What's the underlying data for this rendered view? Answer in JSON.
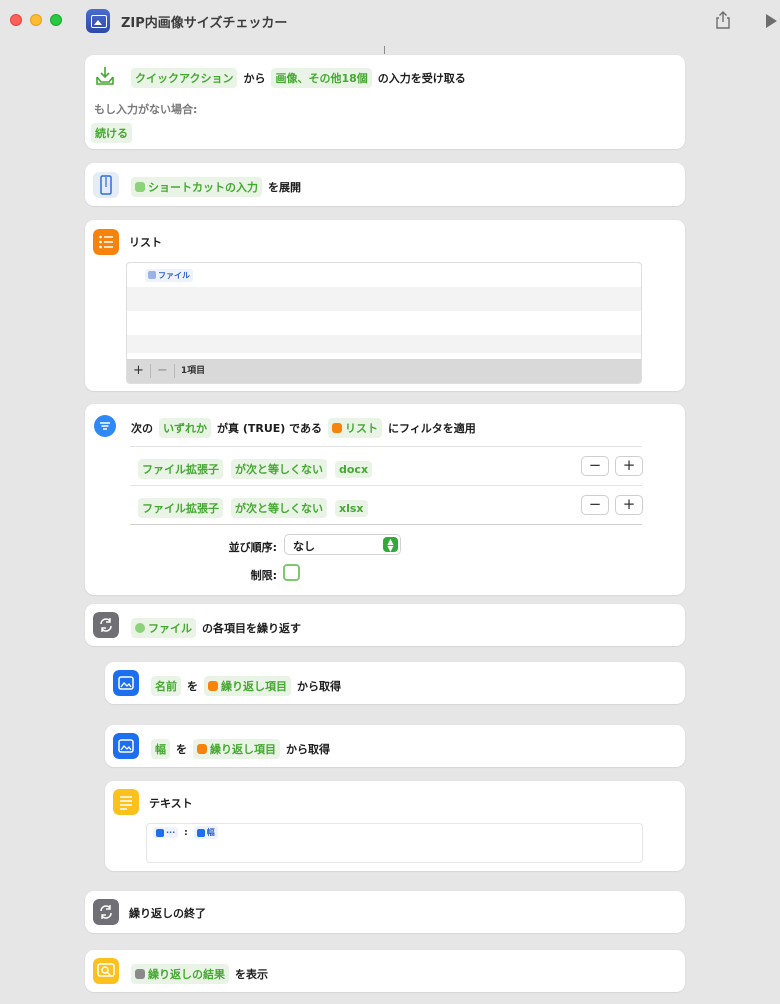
{
  "window": {
    "title": "ZIP内画像サイズチェッカー"
  },
  "actions": {
    "receive": {
      "token1": "クイックアクション",
      "word1": "から",
      "token2": "画像、その他18個",
      "word2": "の入力を受け取る",
      "fallback_label": "もし入力がない場合:",
      "fallback_value": "続ける"
    },
    "expand": {
      "token": "ショートカットの入力",
      "word": "を展開"
    },
    "list": {
      "title": "リスト",
      "items": [
        "ファイル"
      ],
      "add": "+",
      "remove": "−",
      "count": "1項目"
    },
    "filter": {
      "word1": "次の",
      "token1": "いずれか",
      "word2": "が真 (TRUE) である",
      "token2": "リスト",
      "word3": "にフィルタを適用",
      "conditions": [
        {
          "field": "ファイル拡張子",
          "op": "が次と等しくない",
          "value": "docx"
        },
        {
          "field": "ファイル拡張子",
          "op": "が次と等しくない",
          "value": "xlsx"
        }
      ],
      "minus": "−",
      "plus": "+",
      "sort_label": "並び順序:",
      "sort_value": "なし",
      "limit_label": "制限:"
    },
    "repeat": {
      "token": "ファイル",
      "word": "の各項目を繰り返す"
    },
    "get_name": {
      "token1": "名前",
      "word1": "を",
      "token2": "繰り返し項目",
      "word2": "から取得"
    },
    "get_width": {
      "token1": "幅",
      "word1": "を",
      "token2": "繰り返し項目",
      "word2": "から取得"
    },
    "text": {
      "title": "テキスト",
      "var1": "···",
      "separator": ":",
      "var2": "幅"
    },
    "end_repeat": {
      "label": "繰り返しの終了"
    },
    "show": {
      "token": "繰り返しの結果",
      "word": "を表示"
    }
  },
  "colors": {
    "token_green": "#45a832",
    "action_blue": "#1e6ff0",
    "list_orange": "#f7830d",
    "text_yellow": "#fcc11c",
    "repeat_gray": "#6f6f75",
    "filter_blue": "#2f88f5"
  }
}
